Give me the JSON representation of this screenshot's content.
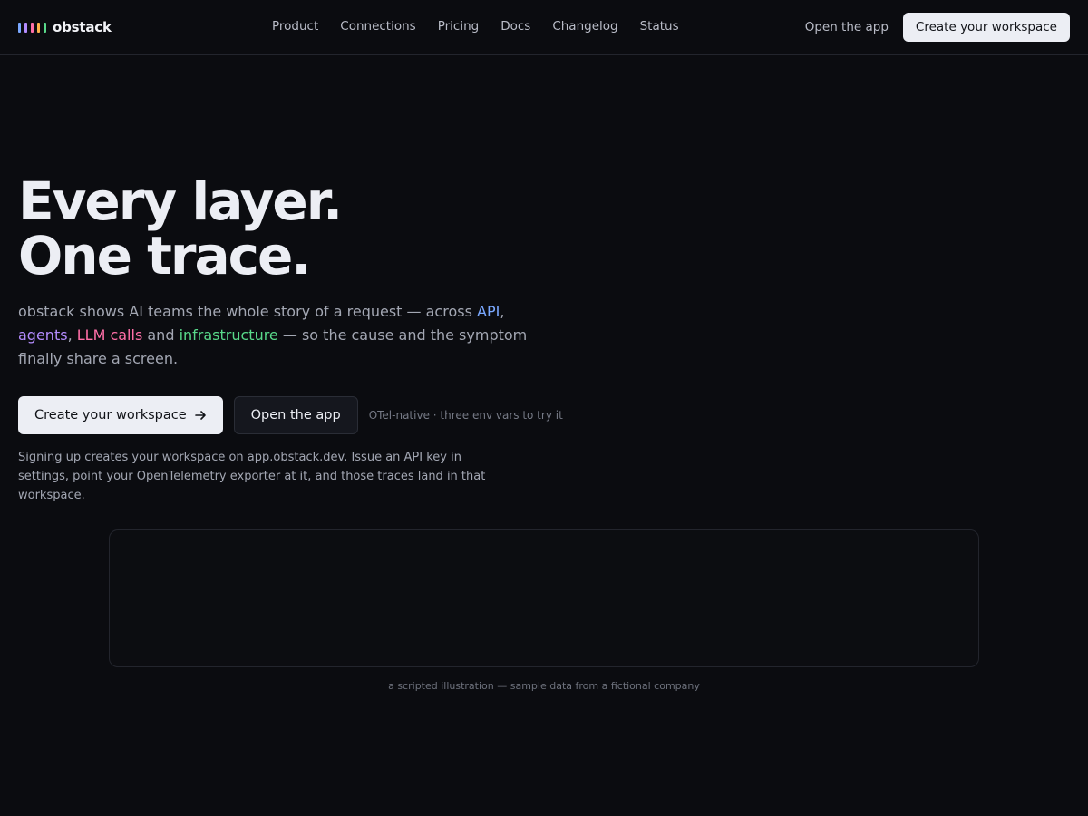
{
  "brand": {
    "name": "obstack",
    "bar_colors": [
      "#7aa8ff",
      "#b48cff",
      "#ff6fa8",
      "#ffb14a",
      "#59d98a"
    ]
  },
  "nav": {
    "links": [
      "Product",
      "Connections",
      "Pricing",
      "Docs",
      "Changelog",
      "Status"
    ],
    "open_app": "Open the app",
    "create_workspace": "Create your workspace"
  },
  "hero": {
    "title_line1": "Every layer.",
    "title_line2": "One trace.",
    "sub": {
      "part1": "obstack shows AI teams the whole story of a request — across ",
      "api": "API",
      "sep1": ", ",
      "agents": "agents",
      "sep2": ", ",
      "llm": "LLM calls",
      "and": " and ",
      "infra": "infrastructure",
      "part2": " — so the cause and the symptom finally share a screen."
    },
    "cta_primary": "Create your workspace",
    "cta_primary_icon": "arrow-right-icon",
    "cta_secondary": "Open the app",
    "cta_note": "OTel-native · three env vars to try it",
    "signup_note": "Signing up creates your workspace on app.obstack.dev. Issue an API key in settings, point your OpenTelemetry exporter at it, and those traces land in that workspace."
  },
  "demo": {
    "caption": "a scripted illustration — sample data from a fictional company"
  },
  "colors": {
    "background": "#0b0c10",
    "api": "#7aa8ff",
    "agents": "#b48cff",
    "llm": "#ff6fa8",
    "infra": "#59d98a"
  }
}
